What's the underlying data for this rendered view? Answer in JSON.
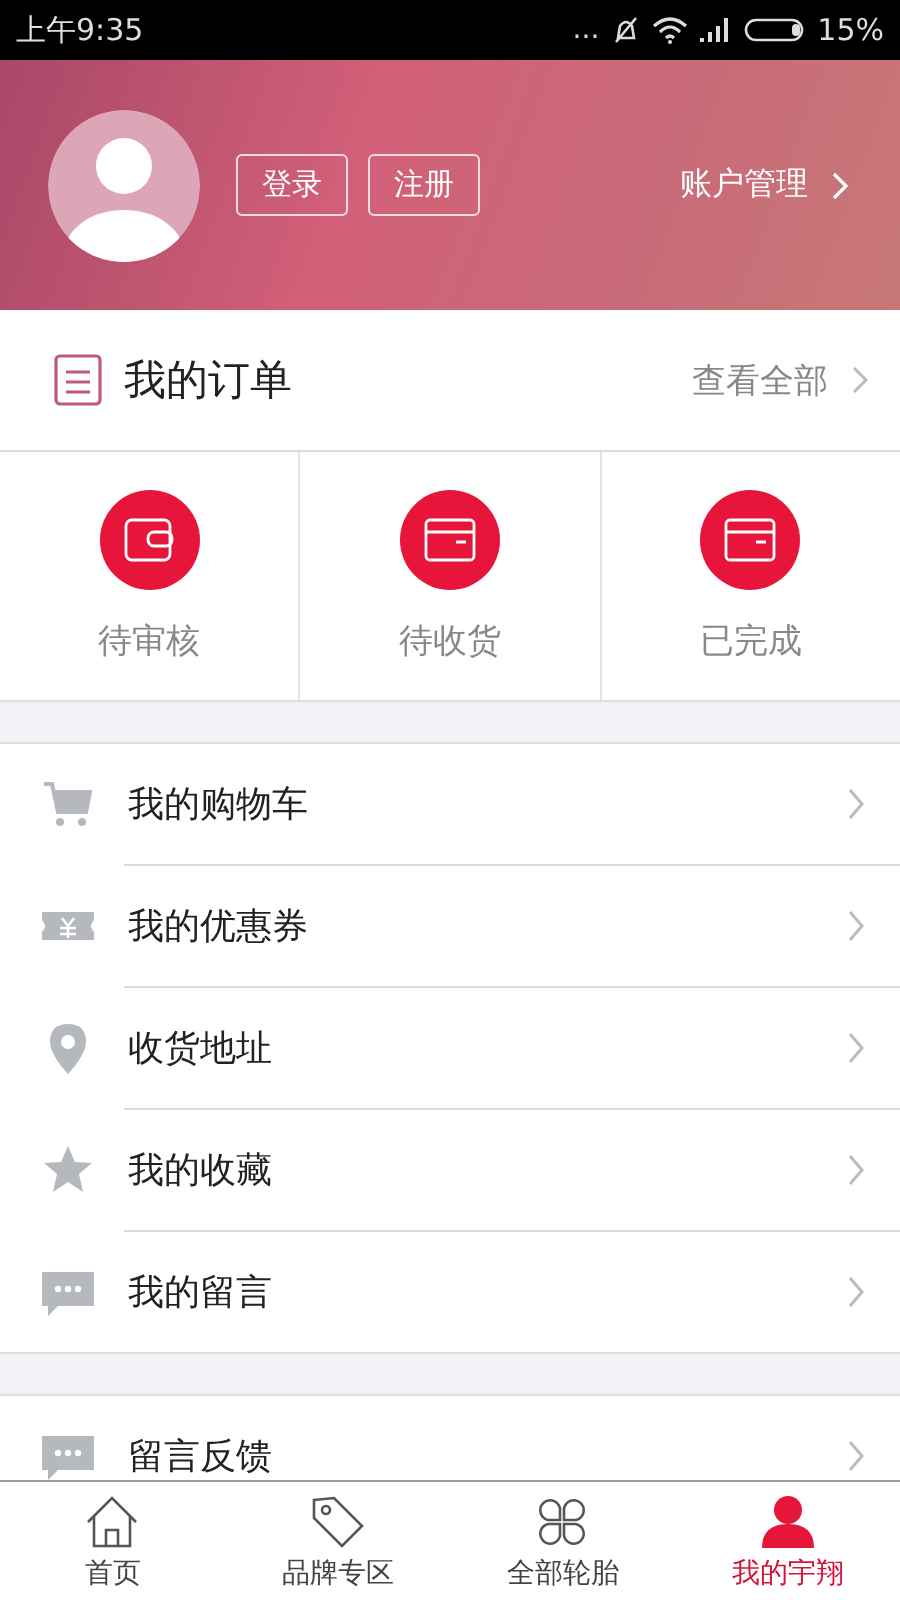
{
  "status_bar": {
    "time": "上午9:35",
    "dots": "...",
    "battery": "15%"
  },
  "profile": {
    "buttons": [
      "登录",
      "注册"
    ],
    "account_link": "账户管理"
  },
  "orders": {
    "title": "我的订单",
    "view_all": "查看全部",
    "statuses": [
      {
        "label": "待审核",
        "kind": "wallet"
      },
      {
        "label": "待收货",
        "kind": "box"
      },
      {
        "label": "已完成",
        "kind": "box"
      }
    ]
  },
  "menu": [
    {
      "label": "我的购物车",
      "kind": "cart"
    },
    {
      "label": "我的优惠券",
      "kind": "coupon"
    },
    {
      "label": "收货地址",
      "kind": "pin"
    },
    {
      "label": "我的收藏",
      "kind": "star"
    },
    {
      "label": "我的留言",
      "kind": "chat"
    }
  ],
  "menu2": [
    {
      "label": "留言反馈",
      "kind": "chat"
    }
  ],
  "tab_bar": [
    {
      "label": "首页",
      "kind": "home",
      "selected": false
    },
    {
      "label": "品牌专区",
      "kind": "tag",
      "selected": false
    },
    {
      "label": "全部轮胎",
      "kind": "clover",
      "selected": false
    },
    {
      "label": "我的宇翔",
      "kind": "person",
      "selected": true
    }
  ]
}
